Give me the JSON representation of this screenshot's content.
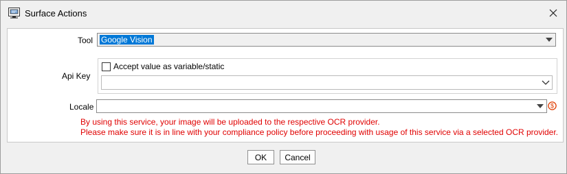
{
  "window": {
    "title": "Surface Actions",
    "app_icon": "window-app-icon",
    "close_icon": "close-icon"
  },
  "form": {
    "tool": {
      "label": "Tool",
      "value": "Google Vision"
    },
    "api_key": {
      "label": "Api Key",
      "checkbox_label": "Accept value as variable/static",
      "checked": false,
      "value": ""
    },
    "locale": {
      "label": "Locale",
      "value": "",
      "indicator_icon": "dollar-circle-icon"
    },
    "warning_line_1": "By using this service, your image will be uploaded to the respective OCR provider.",
    "warning_line_2": "Please make sure it is in line with your compliance policy before proceeding with usage of this service via a selected OCR provider."
  },
  "buttons": {
    "ok": "OK",
    "cancel": "Cancel"
  },
  "colors": {
    "selection": "#0078d7",
    "warning": "#e00000",
    "indicator": "#e03c00"
  }
}
